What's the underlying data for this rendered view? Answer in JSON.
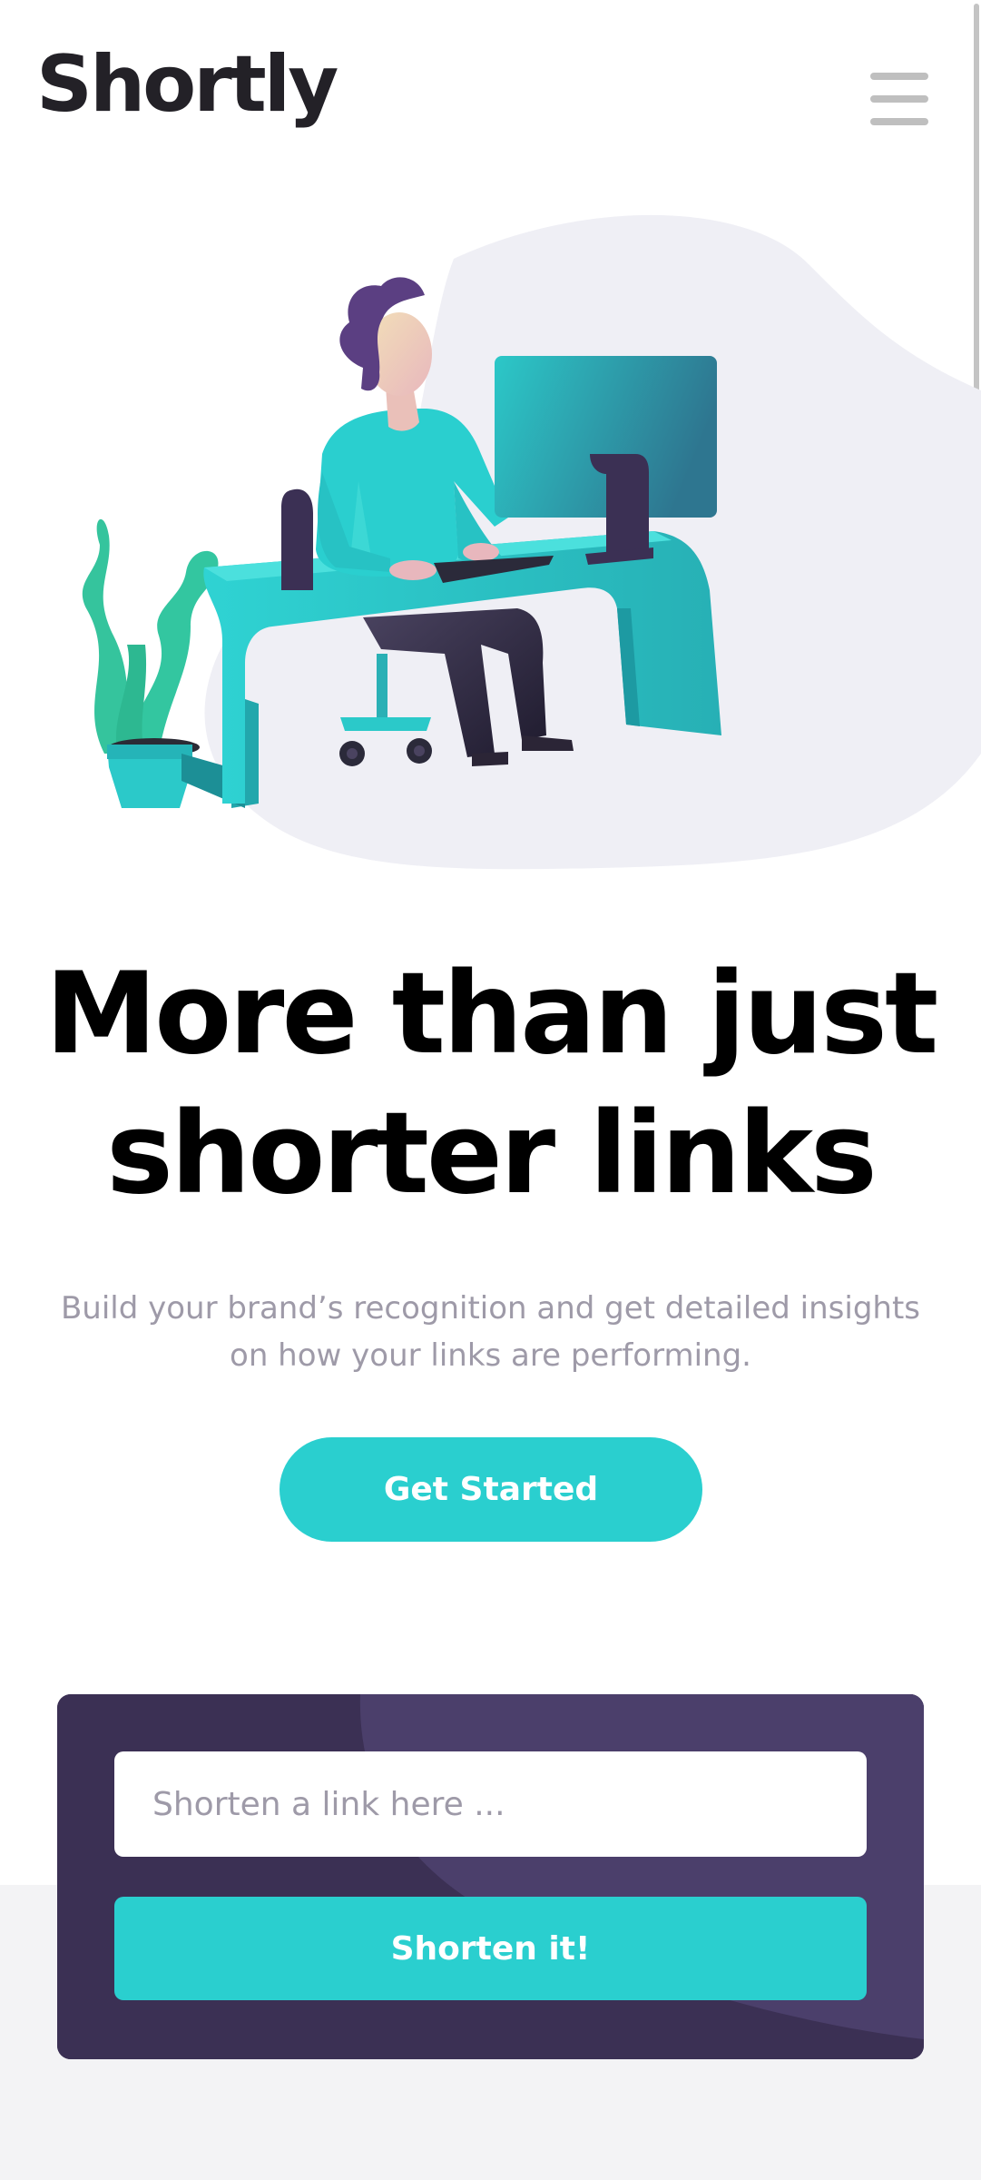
{
  "header": {
    "logo": "Shortly"
  },
  "hero": {
    "title_line1": "More than just",
    "title_line2": "shorter links",
    "subtitle_line1": "Build your brand’s recognition and get detailed insights",
    "subtitle_line2": "on how your links are performing.",
    "cta_label": "Get Started"
  },
  "shorten": {
    "placeholder": "Shorten a link here ...",
    "button_label": "Shorten it!"
  },
  "colors": {
    "cyan": "#2acfcf",
    "dark_violet": "#3b3054",
    "grayish_violet": "#9e9aa8",
    "very_dark_blue": "#232127"
  }
}
